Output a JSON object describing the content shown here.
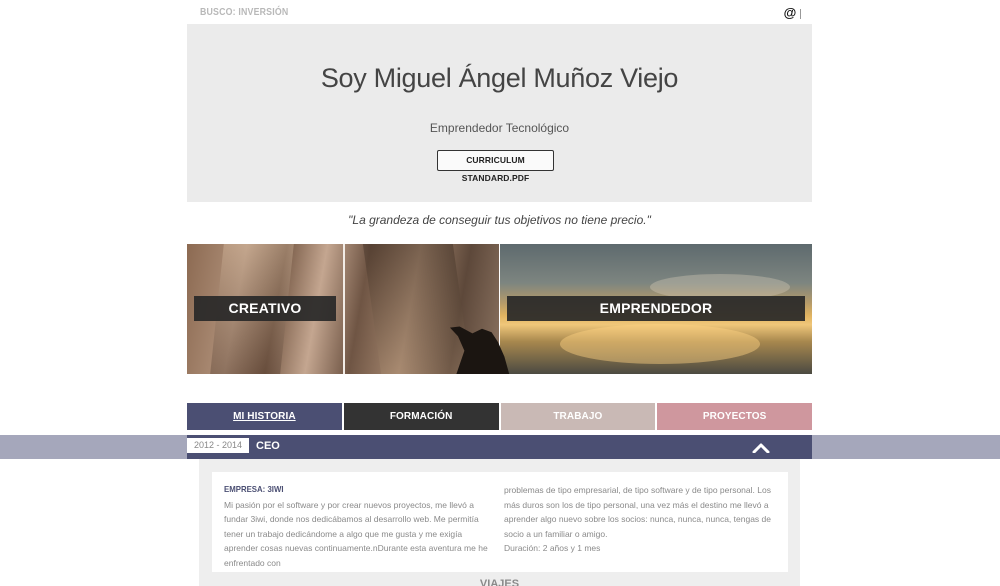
{
  "topbar": {
    "busco_label": "BUSCO: INVERSIÓN",
    "contact_symbol": "@"
  },
  "hero": {
    "name": "Soy Miguel Ángel Muñoz Viejo",
    "role": "Emprendedor Tecnológico",
    "cv_button": "CURRICULUM STANDARD.PDF"
  },
  "quote": "\"La grandeza de conseguir tus objetivos no tiene precio.\"",
  "banners": {
    "left_label": "CREATIVO",
    "right_label": "EMPRENDEDOR"
  },
  "tabs": [
    {
      "label": "MI HISTORIA",
      "color": "#4b4f73",
      "active": true
    },
    {
      "label": "FORMACIÓN",
      "color": "#333333",
      "active": false
    },
    {
      "label": "TRABAJO",
      "color": "#c9b9b5",
      "active": false
    },
    {
      "label": "PROYECTOS",
      "color": "#cf979e",
      "active": false
    }
  ],
  "entry": {
    "period": "2012 - 2014",
    "title": "CEO",
    "toggle_icon": "chevron-up-icon",
    "company": "EMPRESA: 3IWI",
    "text_left": "Mi pasión por el software y por crear nuevos proyectos, me llevó a fundar 3iwi, donde nos dedicábamos al desarrollo web. Me permitía tener un trabajo dedicándome a algo que me gusta y me exigía aprender cosas nuevas continuamente.nDurante esta aventura me he enfrentado con",
    "text_right": "problemas de tipo empresarial, de tipo software y de tipo personal. Los más duros son los de tipo personal, una vez más el destino me llevó a aprender algo nuevo sobre los socios: nunca, nunca, nunca, tengas de socio a un familiar o amigo.",
    "duration": "Duración: 2 años y 1 mes"
  },
  "next_section": "VIAJES",
  "colors": {
    "accent": "#4b4f73",
    "stripe": "#a5a7bb",
    "hero_bg": "#ebebeb"
  }
}
